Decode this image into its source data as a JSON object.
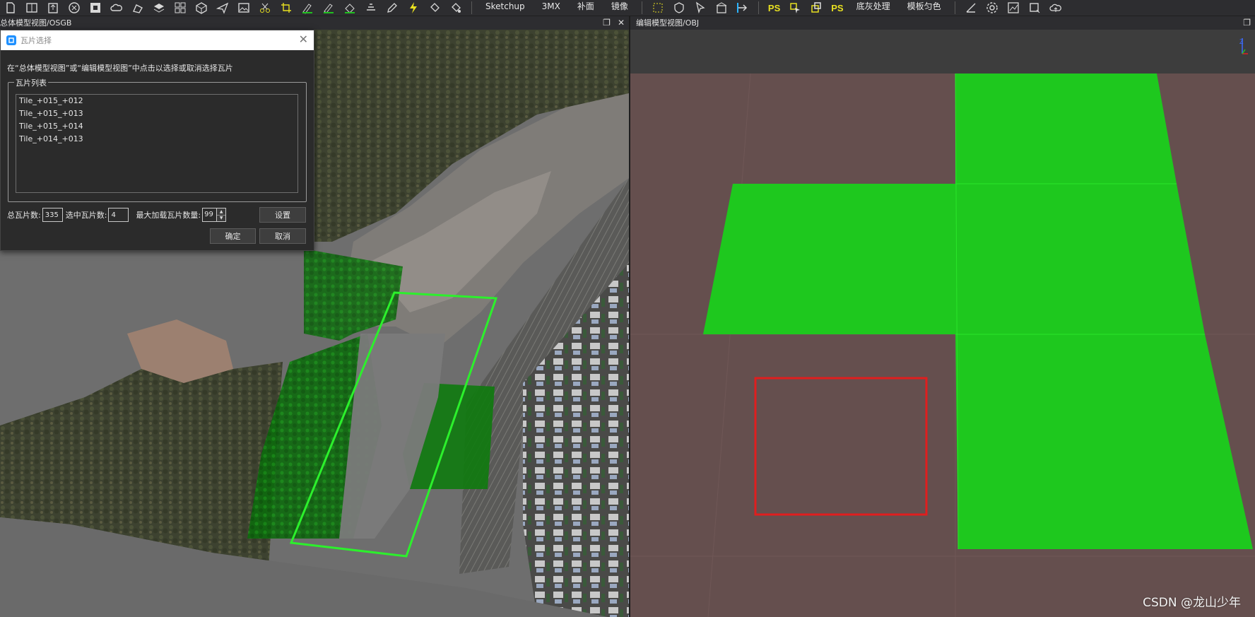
{
  "toolbar": {
    "buttons_left": [
      "new-file-icon",
      "split-view-icon",
      "export-icon",
      "close-circle-icon",
      "stop-icon",
      "cloud-icon",
      "paint-icon",
      "layers-icon",
      "grid-icon",
      "cube-icon",
      "plane-icon",
      "image-icon",
      "cut-icon",
      "crop-icon",
      "draw-a-icon",
      "draw-b-icon",
      "fill-icon",
      "flatten-icon",
      "edit-icon",
      "lightning-icon",
      "bucket-icon",
      "bucket2-icon"
    ],
    "text_items": [
      "Sketchup",
      "3MX",
      "补面",
      "镜像"
    ],
    "buttons_mid": [
      "select-rect-icon",
      "shield-icon",
      "pointer-icon",
      "building-icon",
      "move-arrow-icon"
    ],
    "ps_label": "PS",
    "buttons_mid2": [
      "cursor-pick-icon",
      "copy-icon"
    ],
    "ps_label2": "PS",
    "text_items2": [
      "底灰处理",
      "模板匀色"
    ],
    "buttons_right": [
      "angle-icon",
      "gear-icon",
      "chart-icon",
      "crop2-icon",
      "cloud-upload-icon"
    ]
  },
  "left_panel": {
    "title": "总体模型视图/OSGB",
    "restore": "❐",
    "close": "✕"
  },
  "right_panel": {
    "title": "编辑模型视图/OBJ",
    "restore": "❐"
  },
  "dialog": {
    "title": "瓦片选择",
    "close": "✕",
    "instruction": "在“总体模型视图”或“编辑模型视图”中点击以选择或取消选择瓦片",
    "group_label": "瓦片列表",
    "tiles": [
      "Tile_+015_+012",
      "Tile_+015_+013",
      "Tile_+015_+014",
      "Tile_+014_+013"
    ],
    "total_label": "总瓦片数:",
    "total_value": "335",
    "selected_label": "选中瓦片数:",
    "selected_value": "4",
    "max_label": "最大加载瓦片数量:",
    "max_value": "99",
    "settings_button": "设置",
    "ok_button": "确定",
    "cancel_button": "取消"
  },
  "watermark": "CSDN @龙山少年",
  "colors": {
    "tile_green": "#1ec81e",
    "selection_red": "#e01e1e",
    "ground_brown": "#654f4e",
    "aerial_tile_green": "#0f7d0f"
  }
}
